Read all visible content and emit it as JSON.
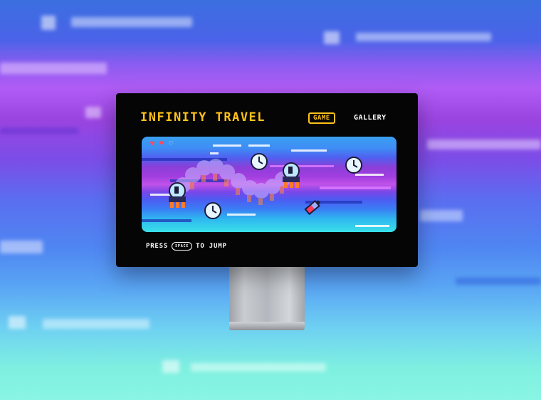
{
  "header": {
    "title": "INFINITY TRAVEL",
    "nav": {
      "game_label": "GAME",
      "gallery_label": "GALLERY"
    }
  },
  "hud": {
    "hearts_total": 3,
    "hearts_filled": 2
  },
  "footer": {
    "press_label": "PRESS",
    "key_label": "SPACE",
    "action_label": "TO JUMP"
  },
  "icons": [
    "heart-icon",
    "clock-icon",
    "battery-icon",
    "ufo-ship-icon"
  ],
  "colors": {
    "accent": "#ffc21a",
    "screen_bg": "#050505",
    "heart": "#ff4a5c"
  }
}
